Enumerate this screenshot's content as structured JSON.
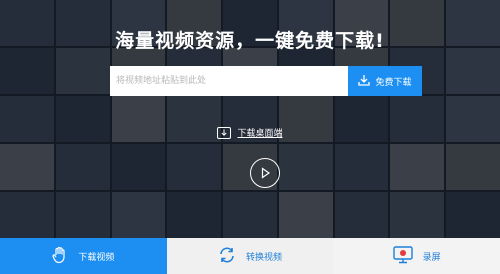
{
  "hero": {
    "headline": "海量视频资源，一键免费下载!"
  },
  "search": {
    "placeholder": "将视频地址粘贴到此处",
    "button_label": "免费下载",
    "button_icon": "download-icon"
  },
  "desktop": {
    "label": "下载桌面端",
    "icon": "download-icon"
  },
  "player": {
    "icon": "play-icon"
  },
  "tabs": [
    {
      "label": "下载视频",
      "icon": "hand-icon",
      "active": true
    },
    {
      "label": "转换视频",
      "icon": "convert-icon",
      "active": false
    },
    {
      "label": "录屏",
      "icon": "screen-record-icon",
      "active": false
    }
  ],
  "colors": {
    "accent": "#1d8ff2",
    "tab_bar": "#ececec",
    "overlay": "#1f2733"
  }
}
